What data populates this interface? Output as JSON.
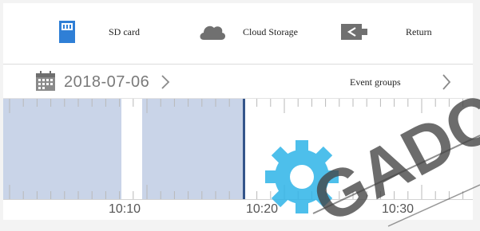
{
  "toolbar": {
    "sd_card": {
      "label": "SD card",
      "icon": "sd-card-icon"
    },
    "cloud_storage": {
      "label": "Cloud Storage",
      "icon": "cloud-icon"
    },
    "return": {
      "label": "Return",
      "icon": "return-icon"
    }
  },
  "date_bar": {
    "date": "2018-07-06",
    "date_chevron": ">",
    "event_groups": "Event groups",
    "event_chevron": ">"
  },
  "timeline": {
    "time_labels": [
      "10:10",
      "10:20",
      "10:30"
    ]
  },
  "watermark": {
    "text": "GADC"
  },
  "colors": {
    "accent_blue": "#2f7fd6",
    "icon_gray": "#707070",
    "recorded_segment": "#c9d4e8",
    "playhead": "#34558a",
    "watermark_text": "#444444",
    "watermark_gear": "#2fb4e8"
  }
}
